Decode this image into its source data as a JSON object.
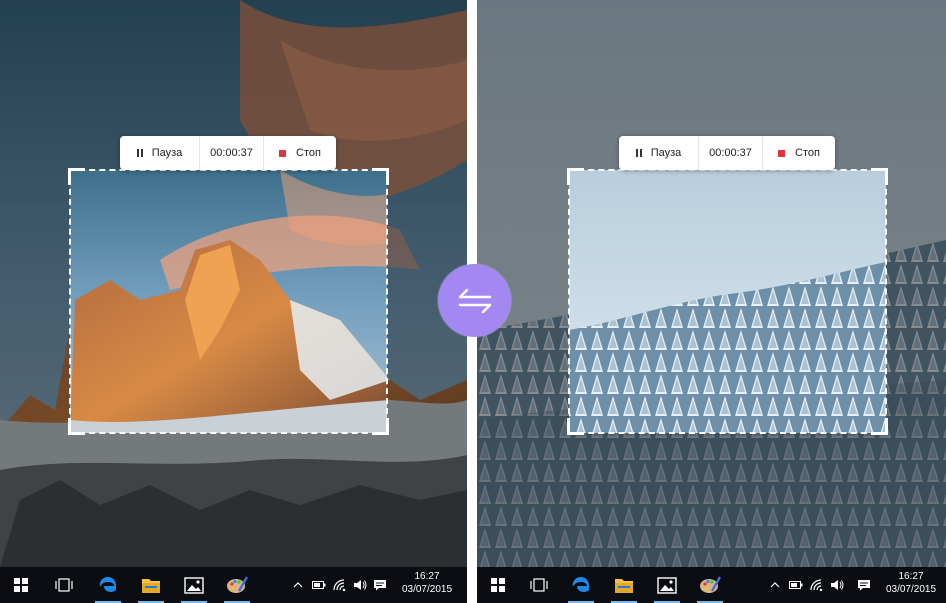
{
  "left": {
    "toolbar": {
      "pause_label": "Пауза",
      "timer": "00:00:37",
      "stop_label": "Стоп"
    },
    "clock": {
      "time": "16:27",
      "date": "03/07/2015"
    }
  },
  "right": {
    "toolbar": {
      "pause_label": "Пауза",
      "timer": "00:00:37",
      "stop_label": "Стоп"
    },
    "clock": {
      "time": "16:27",
      "date": "03/07/2015"
    }
  },
  "icons": {
    "taskbar": [
      "windows-start-icon",
      "task-view-icon",
      "edge-browser-icon",
      "file-explorer-icon",
      "photos-icon",
      "paint-icon"
    ],
    "tray": [
      "show-hidden-icons-icon",
      "battery-icon",
      "wifi-icon",
      "volume-icon",
      "action-center-icon"
    ],
    "center": "swap-arrows-icon"
  },
  "colors": {
    "accent": "#a488f2",
    "stop_red": "#e0343a",
    "taskbar": "#0b0d12",
    "active_indicator": "#76b9ed"
  }
}
